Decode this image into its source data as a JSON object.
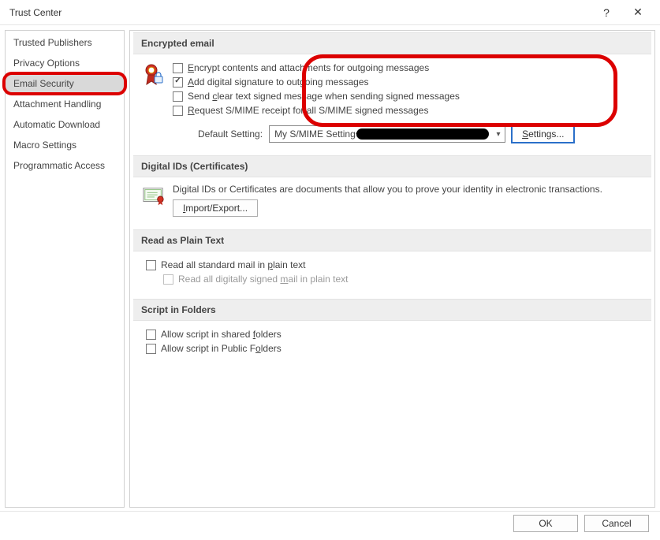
{
  "window": {
    "title": "Trust Center",
    "help": "?",
    "close": "✕"
  },
  "sidebar": {
    "items": [
      {
        "label": "Trusted Publishers"
      },
      {
        "label": "Privacy Options"
      },
      {
        "label": "Email Security"
      },
      {
        "label": "Attachment Handling"
      },
      {
        "label": "Automatic Download"
      },
      {
        "label": "Macro Settings"
      },
      {
        "label": "Programmatic Access"
      }
    ]
  },
  "sections": {
    "encrypted": {
      "title": "Encrypted email",
      "opts": {
        "encrypt": "Encrypt contents and attachments for outgoing messages",
        "sign": "Add digital signature to outgoing messages",
        "cleartext": "Send clear text signed message when sending signed messages",
        "receipt": "Request S/MIME receipt for all S/MIME signed messages"
      },
      "default_label": "Default Setting:",
      "default_value": "My S/MIME Settings",
      "settings_btn": "Settings..."
    },
    "digital": {
      "title": "Digital IDs (Certificates)",
      "desc": "Digital IDs or Certificates are documents that allow you to prove your identity in electronic transactions.",
      "import_btn": "Import/Export..."
    },
    "plaintext": {
      "title": "Read as Plain Text",
      "opt1": "Read all standard mail in plain text",
      "opt2": "Read all digitally signed mail in plain text"
    },
    "script": {
      "title": "Script in Folders",
      "opt1": "Allow script in shared folders",
      "opt2": "Allow script in Public Folders"
    }
  },
  "footer": {
    "ok": "OK",
    "cancel": "Cancel"
  }
}
